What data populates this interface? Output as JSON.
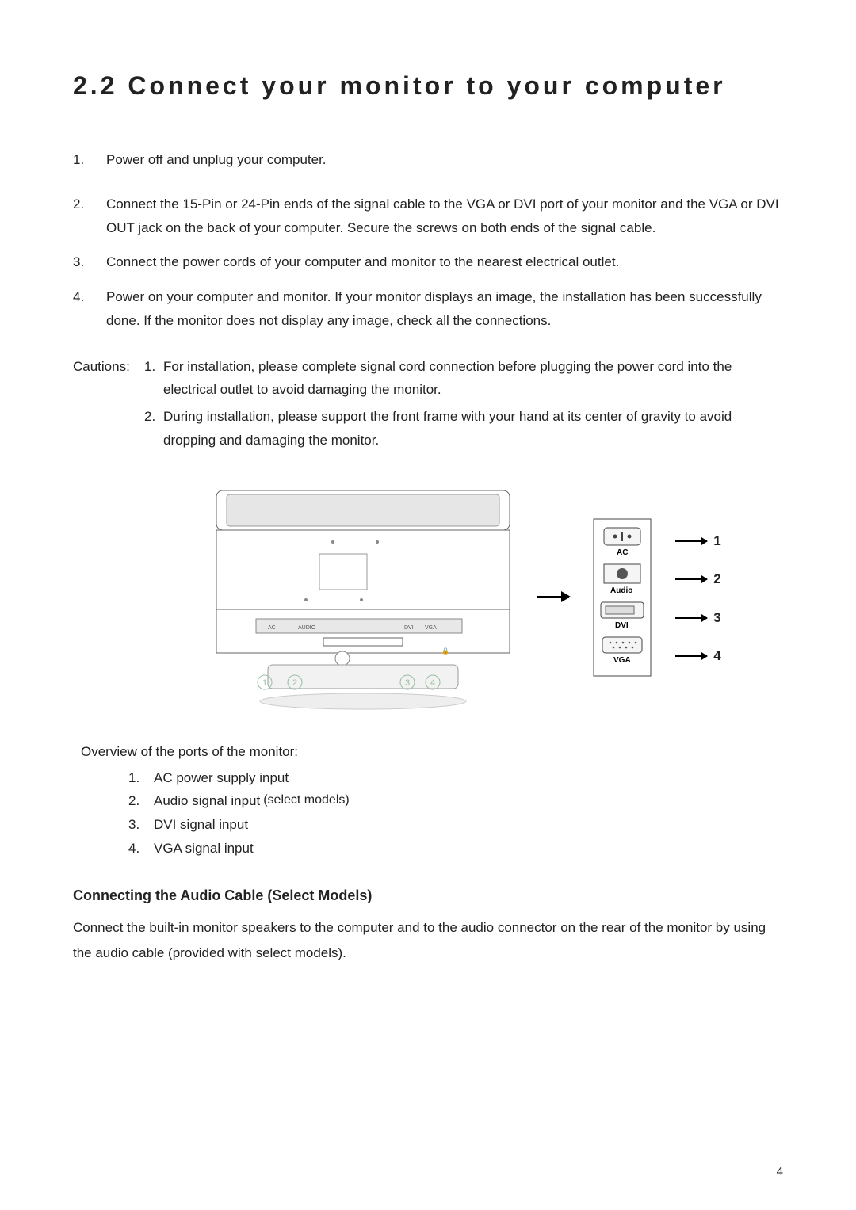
{
  "header": {
    "title": "2.2  Connect your monitor to your computer"
  },
  "steps": [
    {
      "n": "1.",
      "text": "Power off and unplug your computer."
    },
    {
      "n": "2.",
      "text": "Connect the 15-Pin or 24-Pin ends of the signal cable to the VGA or DVI port of your monitor and the VGA or DVI OUT jack on the back of your computer. Secure the screws on both ends of the signal cable."
    },
    {
      "n": "3.",
      "text": "Connect the power cords of your computer and monitor to the nearest electrical outlet."
    },
    {
      "n": "4.",
      "text": "Power on your computer and monitor. If your monitor displays an image, the installation has been successfully done. If the monitor does not display any image, check all the connections."
    }
  ],
  "cautions": {
    "label": "Cautions:",
    "items": [
      {
        "n": "1.",
        "text": "For installation, please complete signal cord connection before plugging the power cord into the electrical outlet to avoid damaging the monitor."
      },
      {
        "n": "2.",
        "text": "During installation, please support the front frame with your hand at its center of gravity to avoid dropping and damaging the monitor."
      }
    ]
  },
  "figure": {
    "port_icons": {
      "ac": "AC",
      "audio": "Audio",
      "dvi": "DVI",
      "vga": "VGA"
    },
    "port_numbers": [
      "1",
      "2",
      "3",
      "4"
    ]
  },
  "overview": {
    "heading": "Overview of the ports of the monitor:",
    "items": [
      {
        "n": "1.",
        "text": "AC power supply input",
        "note": ""
      },
      {
        "n": "2.",
        "text": "Audio signal input",
        "note": "(select models)"
      },
      {
        "n": "3.",
        "text": "DVI signal input",
        "note": ""
      },
      {
        "n": "4.",
        "text": "VGA signal input",
        "note": ""
      }
    ]
  },
  "audio_section": {
    "heading": "Connecting the Audio Cable (Select Models)",
    "body": "Connect the built-in monitor speakers to the computer and to the audio connector on the rear of the monitor by using the audio cable (provided with select models)."
  },
  "page_number": "4"
}
